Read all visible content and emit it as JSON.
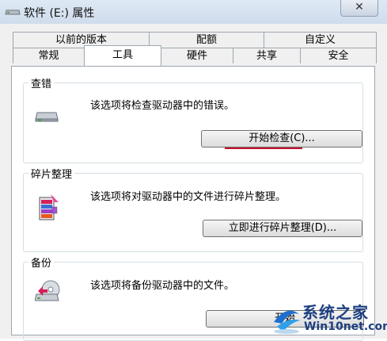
{
  "window": {
    "title": "软件 (E:) 属性",
    "close_symbol": "✕"
  },
  "tabs_row1": [
    "以前的版本",
    "配额",
    "自定义"
  ],
  "tabs_row2": [
    "常规",
    "工具",
    "硬件",
    "共享",
    "安全"
  ],
  "active_tab": "工具",
  "sections": {
    "error_check": {
      "title": "查错",
      "description": "该选项将检查驱动器中的错误。",
      "button": "开始检查(C)..."
    },
    "defrag": {
      "title": "碎片整理",
      "description": "该选项将对驱动器中的文件进行碎片整理。",
      "button": "立即进行碎片整理(D)..."
    },
    "backup": {
      "title": "备份",
      "description": "该选项将备份驱动器中的文件。",
      "button": "开始"
    }
  },
  "watermark": {
    "brand": "系统之家",
    "url": "Win10net.com"
  },
  "colors": {
    "highlight_underline": "#c8102e",
    "watermark_blue": "#1d3f80"
  }
}
